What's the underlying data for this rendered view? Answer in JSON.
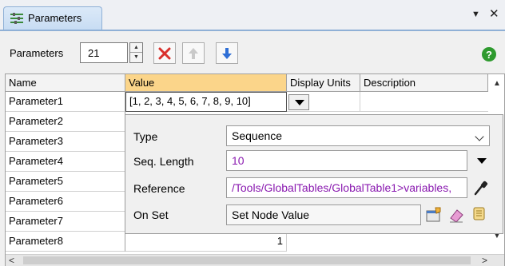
{
  "tab": {
    "title": "Parameters"
  },
  "window": {
    "menu_glyph": "▼",
    "close_glyph": "✕"
  },
  "toolbar": {
    "label": "Parameters",
    "count": "21"
  },
  "table": {
    "columns": [
      "Name",
      "Value",
      "Display Units",
      "Description"
    ],
    "rows": [
      {
        "name": "Parameter1",
        "value": "[1, 2, 3, 4, 5, 6, 7, 8, 9, 10]"
      },
      {
        "name": "Parameter2",
        "value": ""
      },
      {
        "name": "Parameter3",
        "value": ""
      },
      {
        "name": "Parameter4",
        "value": ""
      },
      {
        "name": "Parameter5",
        "value": ""
      },
      {
        "name": "Parameter6",
        "value": ""
      },
      {
        "name": "Parameter7",
        "value": ""
      },
      {
        "name": "Parameter8",
        "value": "1"
      }
    ]
  },
  "popup": {
    "type_label": "Type",
    "type_value": "Sequence",
    "seq_length_label": "Seq. Length",
    "seq_length_value": "10",
    "reference_label": "Reference",
    "reference_value": "/Tools/GlobalTables/GlobalTable1>variables,",
    "onset_label": "On Set",
    "onset_value": "Set Node Value"
  },
  "colors": {
    "accent_header": "#fbd58a",
    "purple_text": "#8a1ab0",
    "delete_red": "#d9302c",
    "move_blue": "#2f6fd6",
    "help_green": "#2e9a2e"
  }
}
